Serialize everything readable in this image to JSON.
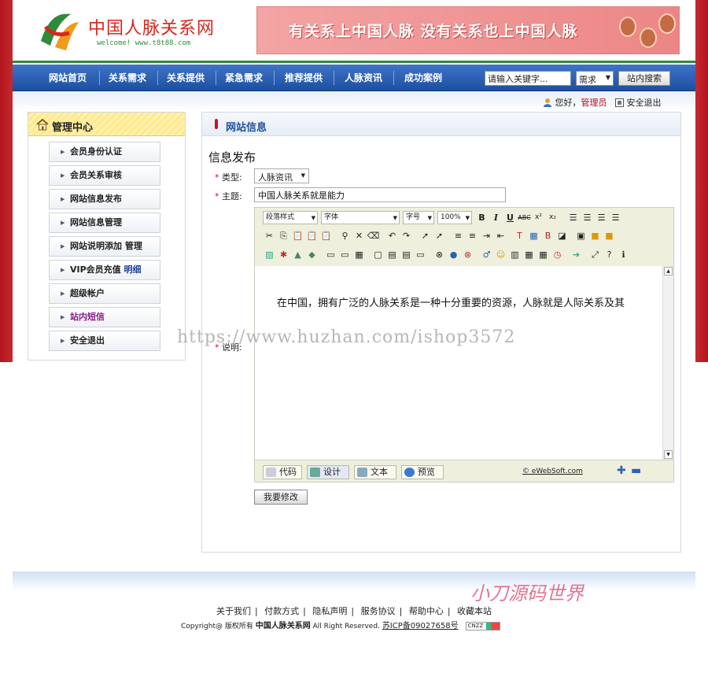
{
  "header": {
    "logo_title": "中国人脉关系网",
    "logo_sub": "welcome! www.t8t88.com",
    "banner_text": "有关系上中国人脉  没有关系也上中国人脉"
  },
  "nav": {
    "items": [
      "网站首页",
      "关系需求",
      "关系提供",
      "紧急需求",
      "推荐提供",
      "人脉资讯",
      "成功案例"
    ],
    "search_placeholder": "请输入关键字...",
    "search_type": "需求",
    "search_button": "站内搜索"
  },
  "user": {
    "greeting": "您好，",
    "role": "管理员",
    "logout": "安全退出"
  },
  "sidebar": {
    "title": "管理中心",
    "items": [
      {
        "label": "会员身份认证"
      },
      {
        "label": "会员关系审核"
      },
      {
        "label": "网站信息发布"
      },
      {
        "label": "网站信息管理"
      },
      {
        "label": "网站说明添加",
        "extra": "管理"
      },
      {
        "label": "VIP会员充值",
        "extra": "明细"
      },
      {
        "label": "超级帐户"
      },
      {
        "label": "站内短信"
      },
      {
        "label": "安全退出"
      }
    ]
  },
  "main": {
    "section_title": "网站信息",
    "form_title": "信息发布",
    "type_label": "类型:",
    "type_value": "人脉资讯",
    "subject_label": "主题:",
    "subject_value": "中国人脉关系就是能力",
    "desc_label": "说明:",
    "submit_label": "我要修改"
  },
  "editor": {
    "paragraph_style": "段落样式",
    "font": "字体",
    "font_size": "字号",
    "zoom": "100%",
    "content": "在中国，拥有广泛的人脉关系是一种十分重要的资源，人脉就是人际关系及其",
    "modes": [
      "代码",
      "设计",
      "文本",
      "预览"
    ],
    "brand": "© eWebSoft.com"
  },
  "watermark": "https://www.huzhan.com/ishop3572",
  "watermark2": "小刀源码世界",
  "footer": {
    "links": [
      "关于我们",
      "付款方式",
      "隐私声明",
      "服务协议",
      "帮助中心",
      "收藏本站"
    ],
    "copyright_prefix": "Copyright@ 版权所有",
    "site_name": "中国人脉关系网",
    "rights": "All Right Reserved.",
    "icp": "苏ICP备09027658号",
    "cnzz": "CNZZ"
  }
}
